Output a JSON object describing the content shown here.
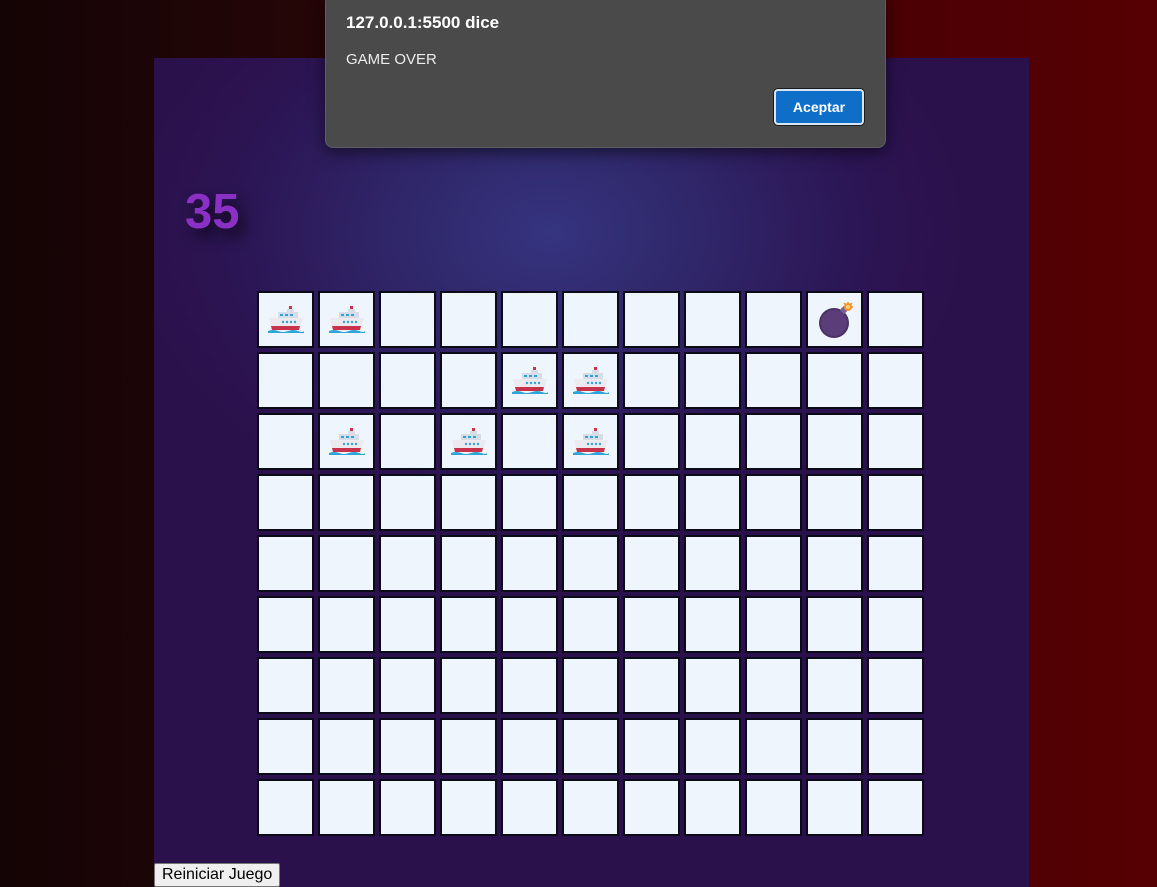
{
  "score": "35",
  "restart_label": "Reiniciar Juego",
  "dialog": {
    "title": "127.0.0.1:5500 dice",
    "message": "GAME OVER",
    "ok_label": "Aceptar"
  },
  "board": {
    "rows": 9,
    "cols": 11,
    "cells": [
      [
        "ship",
        "ship",
        "",
        "",
        "",
        "",
        "",
        "",
        "",
        "bomb",
        ""
      ],
      [
        "",
        "",
        "",
        "",
        "ship",
        "ship",
        "",
        "",
        "",
        "",
        ""
      ],
      [
        "",
        "ship",
        "",
        "ship",
        "",
        "ship",
        "",
        "",
        "",
        "",
        ""
      ],
      [
        "",
        "",
        "",
        "",
        "",
        "",
        "",
        "",
        "",
        "",
        ""
      ],
      [
        "",
        "",
        "",
        "",
        "",
        "",
        "",
        "",
        "",
        "",
        ""
      ],
      [
        "",
        "",
        "",
        "",
        "",
        "",
        "",
        "",
        "",
        "",
        ""
      ],
      [
        "",
        "",
        "",
        "",
        "",
        "",
        "",
        "",
        "",
        "",
        ""
      ],
      [
        "",
        "",
        "",
        "",
        "",
        "",
        "",
        "",
        "",
        "",
        ""
      ],
      [
        "",
        "",
        "",
        "",
        "",
        "",
        "",
        "",
        "",
        "",
        ""
      ]
    ]
  },
  "icons": {
    "ship": "ship-icon",
    "bomb": "bomb-icon"
  },
  "colors": {
    "score": "#8b30c4",
    "cell_bg": "#eef5fd",
    "dialog_bg": "#4a4a4a",
    "dialog_button": "#0f6fc8"
  }
}
